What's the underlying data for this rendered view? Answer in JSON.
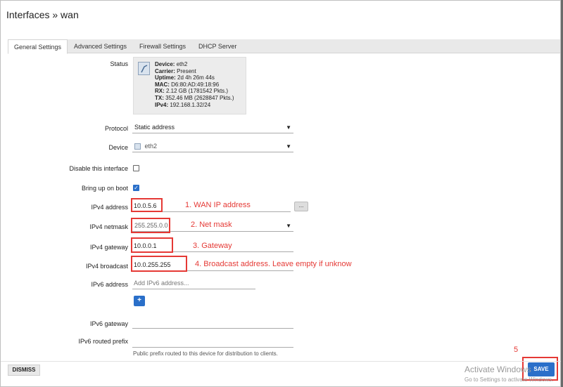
{
  "window": {
    "title": "Interfaces » wan"
  },
  "tabs": [
    {
      "label": "General Settings",
      "active": true
    },
    {
      "label": "Advanced Settings",
      "active": false
    },
    {
      "label": "Firewall Settings",
      "active": false
    },
    {
      "label": "DHCP Server",
      "active": false
    }
  ],
  "status": {
    "label": "Status",
    "icon": "ethernet-port-icon",
    "lines": [
      {
        "key": "Device:",
        "value": " eth2"
      },
      {
        "key": "Carrier:",
        "value": " Present"
      },
      {
        "key": "Uptime:",
        "value": " 2d 4h 26m 44s"
      },
      {
        "key": "MAC:",
        "value": " D6:80:AD:49:18:96"
      },
      {
        "key": "RX:",
        "value": " 2.12 GB (1781542 Pkts.)"
      },
      {
        "key": "TX:",
        "value": " 352.46 MB (2628847 Pkts.)"
      },
      {
        "key": "IPv4:",
        "value": " 192.168.1.32/24"
      }
    ]
  },
  "fields": {
    "protocol": {
      "label": "Protocol",
      "value": "Static address"
    },
    "device": {
      "label": "Device",
      "value": "eth2"
    },
    "disable": {
      "label": "Disable this interface",
      "checked": false
    },
    "boot": {
      "label": "Bring up on boot",
      "checked": true
    },
    "ipv4_address": {
      "label": "IPv4 address",
      "value": "10.0.5.6",
      "button": "..."
    },
    "ipv4_netmask": {
      "label": "IPv4 netmask",
      "value": "255.255.0.0"
    },
    "ipv4_gateway": {
      "label": "IPv4 gateway",
      "value": "10.0.0.1"
    },
    "ipv4_broadcast": {
      "label": "IPv4 broadcast",
      "value": "10.0.255.255"
    },
    "ipv6_address": {
      "label": "IPv6 address",
      "placeholder": "Add IPv6 address...",
      "add_button": "+"
    },
    "ipv6_gateway": {
      "label": "IPv6 gateway",
      "value": ""
    },
    "ipv6_prefix": {
      "label": "IPv6 routed prefix",
      "value": "",
      "hint": "Public prefix routed to this device for distribution to clients."
    }
  },
  "annotations": {
    "a1": "1. WAN IP address",
    "a2": "2. Net mask",
    "a3": "3. Gateway",
    "a4": "4. Broadcast address. Leave empty if unknow",
    "a5": "5",
    "color": "#e53935"
  },
  "footer": {
    "dismiss": "DISMISS",
    "save": "SAVE"
  },
  "watermark": {
    "line1": "Activate Windows",
    "line2": "Go to Settings to activate Windows."
  },
  "colors": {
    "accent": "#2a6fc9"
  }
}
